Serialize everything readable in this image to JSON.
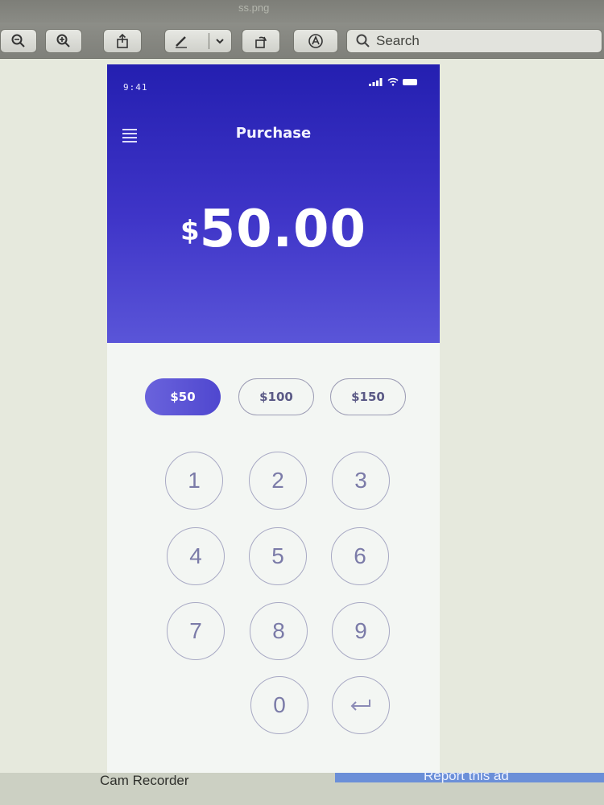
{
  "window": {
    "doc_name": "ss.png"
  },
  "toolbar": {
    "search_placeholder": "Search",
    "icons": [
      "zoom-out-icon",
      "zoom-in-icon",
      "share-icon",
      "markup-pen-icon",
      "chevron-down-icon",
      "rotate-icon",
      "annotate-icon",
      "search-icon"
    ]
  },
  "phone": {
    "status_time": "9:41",
    "title": "Purchase",
    "amount_currency": "$",
    "amount_value": "50.00",
    "presets": [
      {
        "label": "$50",
        "active": true
      },
      {
        "label": "$100",
        "active": false
      },
      {
        "label": "$150",
        "active": false
      }
    ],
    "keys": [
      "1",
      "2",
      "3",
      "4",
      "5",
      "6",
      "7",
      "8",
      "9",
      "0"
    ],
    "backspace_icon": "return-arrow-icon",
    "colors": {
      "hero_top": "#241fb0",
      "hero_bottom": "#5a55d8",
      "accent": "#5b54d6"
    }
  },
  "banner": {
    "left_text": "Cam Recorder",
    "right_text": "Report this ad"
  }
}
